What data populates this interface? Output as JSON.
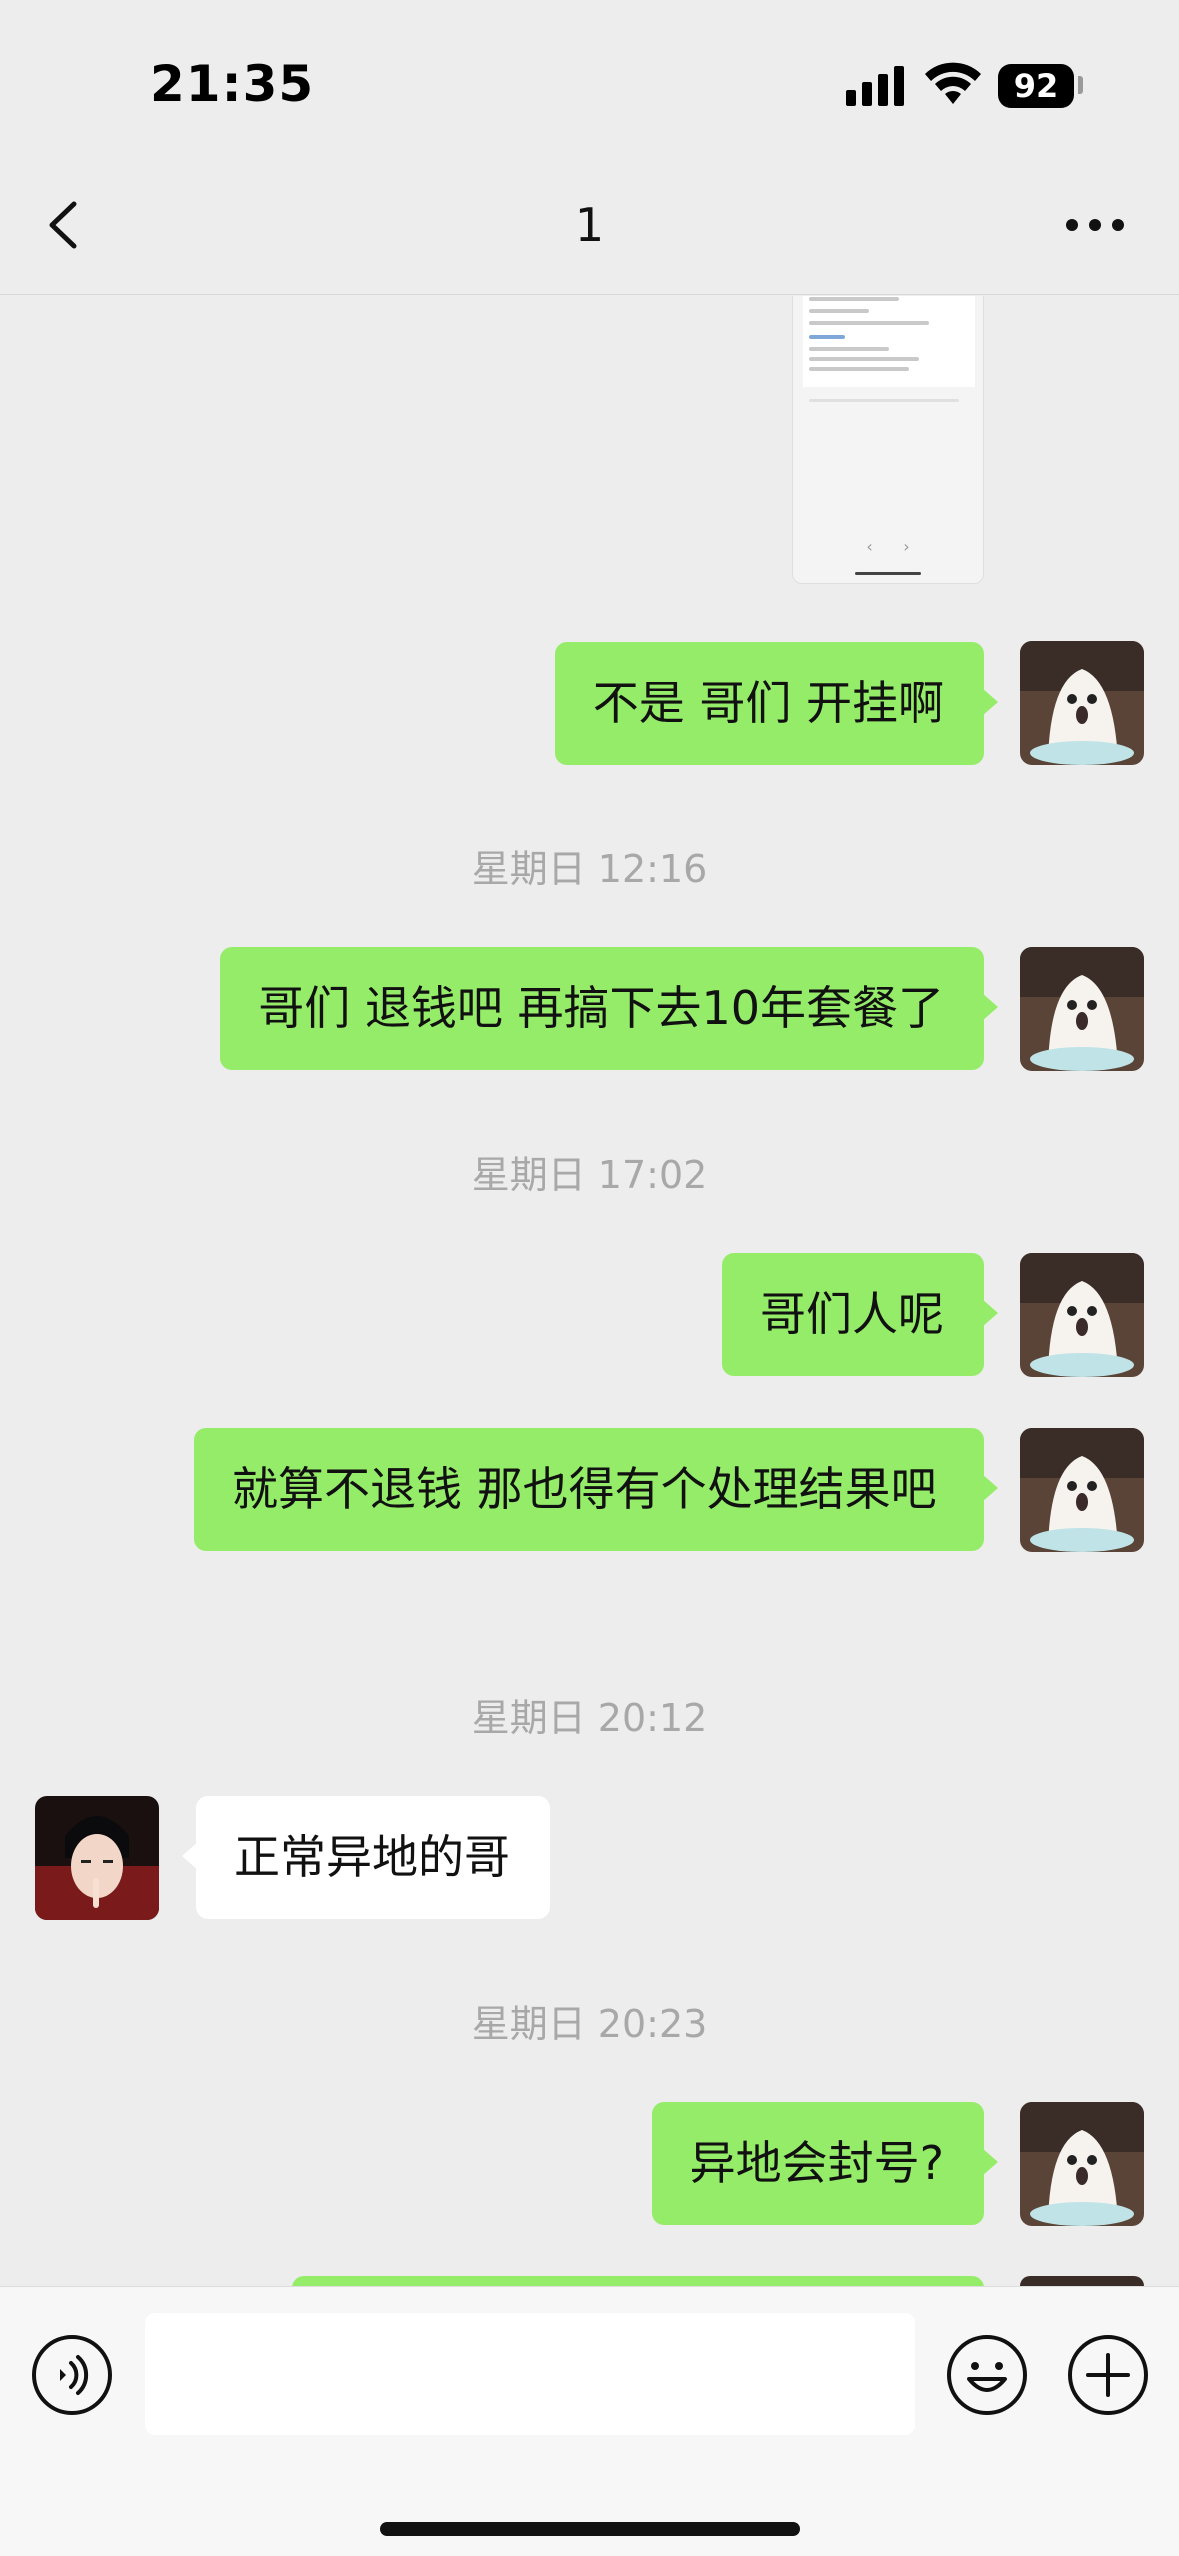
{
  "status_bar": {
    "time": "21:35",
    "battery": "92"
  },
  "nav": {
    "title": "1",
    "back_icon": "chevron-left-icon",
    "more_icon": "ellipsis-icon"
  },
  "chat": {
    "timestamps": [
      "星期日 12:16",
      "星期日 17:02",
      "星期日 20:12",
      "星期日 20:23"
    ],
    "messages": [
      {
        "side": "sent",
        "text": "不是 哥们 开挂啊"
      },
      {
        "side": "sent",
        "text": "哥们 退钱吧 再搞下去10年套餐了"
      },
      {
        "side": "sent",
        "text": "哥们人呢"
      },
      {
        "side": "sent",
        "text": "就算不退钱 那也得有个处理结果吧"
      },
      {
        "side": "received",
        "text": "正常异地的哥"
      },
      {
        "side": "sent",
        "text": "异地会封号?"
      }
    ]
  },
  "input_bar": {
    "placeholder": "",
    "voice_icon": "voice-icon",
    "emoji_icon": "emoji-icon",
    "plus_icon": "plus-icon"
  },
  "colors": {
    "sent_bubble": "#95ec69",
    "received_bubble": "#ffffff",
    "background": "#ededed"
  }
}
